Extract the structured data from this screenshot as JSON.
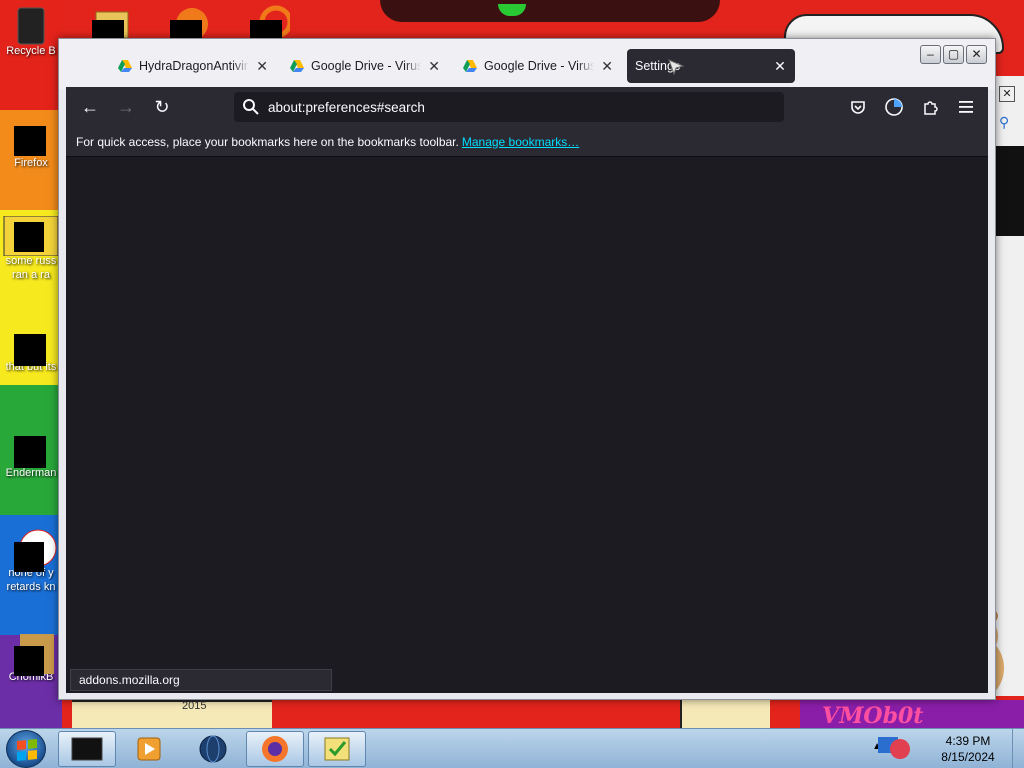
{
  "desktop": {
    "icons": [
      {
        "label": "Recycle B"
      },
      {
        "label": "Firefox"
      },
      {
        "label": "some russ ran a ra"
      },
      {
        "label": "that but its"
      },
      {
        "label": "Enderman"
      },
      {
        "label": "none of y retards kn"
      },
      {
        "label": "ChomikB"
      }
    ],
    "wallpaper_year": "2015",
    "wallpaper_logo": "VMOb0t"
  },
  "browser": {
    "tabs": [
      {
        "label": "HydraDragonAntivirus",
        "icon": "google-drive-icon",
        "active": false
      },
      {
        "label": "Google Drive - Virus sc",
        "icon": "google-drive-icon",
        "active": false
      },
      {
        "label": "Google Drive - Virus sc",
        "icon": "google-drive-icon",
        "active": false
      },
      {
        "label": "Settings",
        "icon": "",
        "active": true
      }
    ],
    "close_glyph": "✕",
    "window_buttons": {
      "minimize": "–",
      "maximize": "▢",
      "close": "✕"
    },
    "nav": {
      "back": "←",
      "forward": "→",
      "reload": "↻"
    },
    "url": "about:preferences#search",
    "bookmarks_bar": {
      "message": "For quick access, place your bookmarks here on the bookmarks toolbar.",
      "link": "Manage bookmarks…"
    },
    "status_text": "addons.mozilla.org",
    "colors": {
      "chrome": "#2b2a33",
      "content": "#1c1b22",
      "link": "#00ddff"
    }
  },
  "taskbar": {
    "time": "4:39 PM",
    "date": "8/15/2024",
    "items": [
      "terminal-icon",
      "media-player-icon",
      "globe-icon",
      "firefox-icon",
      "task-checklist-icon"
    ]
  }
}
